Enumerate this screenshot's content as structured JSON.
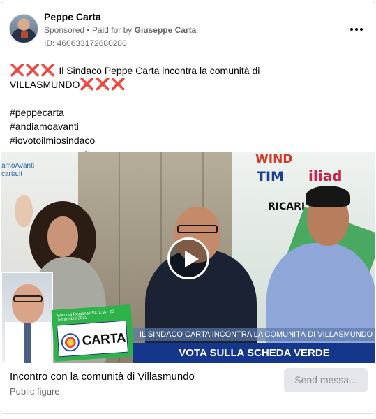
{
  "post": {
    "author": "Peppe Carta",
    "sponsored": "Sponsored",
    "paid_for_prefix": " • Paid for by ",
    "payer": "Giuseppe Carta",
    "ad_id": "ID: 460633172680280",
    "more_icon": "more-horizontal-icon"
  },
  "body": {
    "marks_left": "❌❌❌",
    "headline": " Il Sindaco Peppe Carta incontra la comunità di VILLASMUNDO",
    "marks_right": "❌❌❌",
    "hashtags": [
      "#peppecarta",
      "#andiamoavanti",
      "#iovotoilmiosindaco"
    ],
    "link": "www.peppecarta.it"
  },
  "video": {
    "play_icon": "play-icon",
    "poster_text_1": "amoAvanti",
    "poster_text_2": "carta.it",
    "store_logos": [
      "WIND",
      "TIM",
      "iliad",
      "RICARI"
    ],
    "ballot_header": "Elezioni Regionali SICILIA · 25 Settembre 2022",
    "ballot_name": "CARTA",
    "caption": "IL SINDACO CARTA INCONTRA LA COMUNITÀ DI VILLASMUNDO",
    "banner": "VOTA SULLA SCHEDA VERDE"
  },
  "footer": {
    "title": "Incontro con la comunità di Villasmundo",
    "subtitle": "Public figure",
    "send_button": "Send messa..."
  }
}
